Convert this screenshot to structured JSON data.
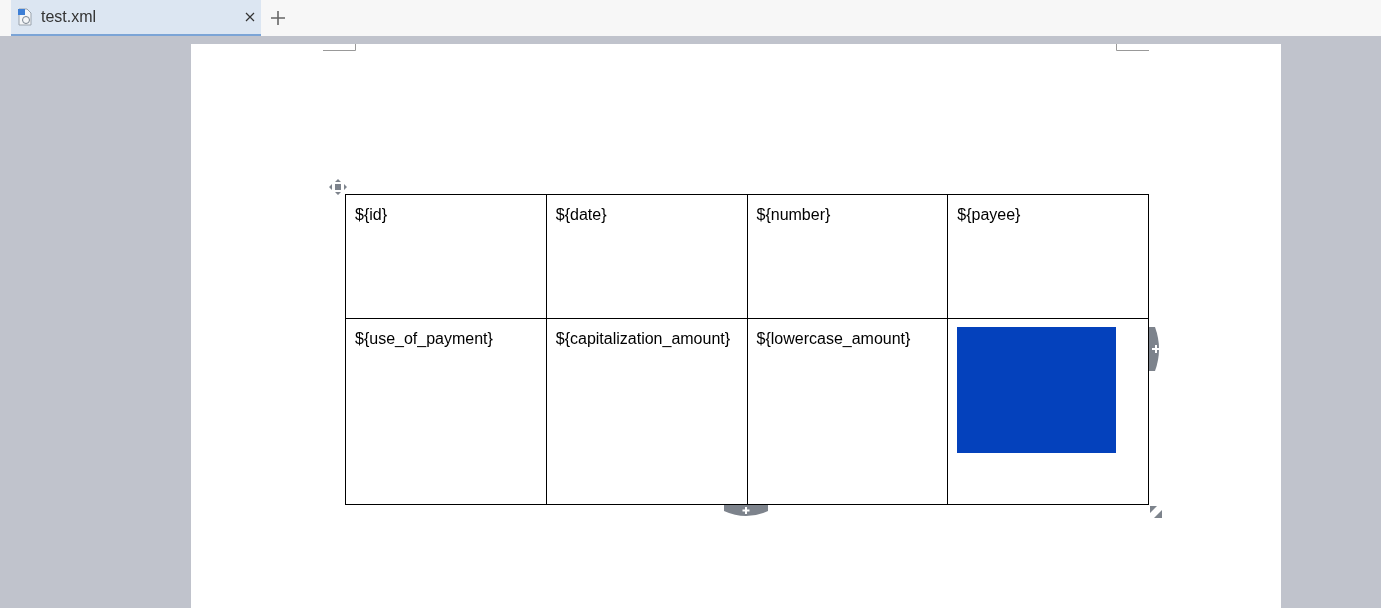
{
  "tabs": [
    {
      "label": "test.xml",
      "selected": true
    }
  ],
  "table": {
    "rows": [
      [
        {
          "kind": "text",
          "text": "${id}"
        },
        {
          "kind": "text",
          "text": "${date}"
        },
        {
          "kind": "text",
          "text": "${number}"
        },
        {
          "kind": "text",
          "text": "${payee}"
        }
      ],
      [
        {
          "kind": "text",
          "text": "${use_of_payment}"
        },
        {
          "kind": "text",
          "text": "${capitalization_amount}"
        },
        {
          "kind": "text",
          "text": "${lowercase_amount}"
        },
        {
          "kind": "image"
        }
      ]
    ]
  }
}
